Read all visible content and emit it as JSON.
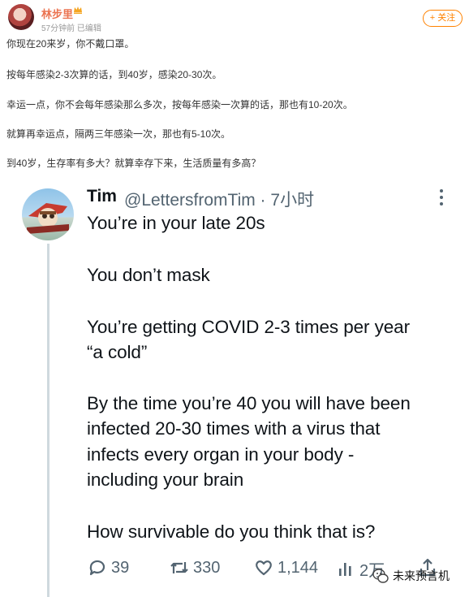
{
  "weibo": {
    "author": "林步里",
    "meta": "57分钟前 已编辑",
    "follow_label": "+ 关注",
    "lines": [
      "你现在20来岁，你不戴口罩。",
      "按每年感染2-3次算的话，到40岁，感染20-30次。",
      "幸运一点，你不会每年感染那么多次，按每年感染一次算的话，那也有10-20次。",
      "就算再幸运点，隔两三年感染一次，那也有5-10次。",
      "到40岁，生存率有多大？就算幸存下来，生活质量有多高？"
    ]
  },
  "tweet": {
    "name": "Tim",
    "handle_time": "@LettersfromTim · 7小时",
    "lines": [
      "You’re in your late 20s",
      "You don’t mask",
      "You’re getting COVID 2-3 times per year",
      "“a cold”",
      "By the time you’re 40 you will have been",
      "infected 20-30 times with a virus that",
      "infects every organ in your body -",
      "including your brain",
      "How survivable do you think that is?"
    ],
    "actions": {
      "replies": "39",
      "retweets": "330",
      "likes": "1,144",
      "views": "2万"
    }
  },
  "watermark": "未来预言机",
  "colors": {
    "weibo_accent": "#eb7350",
    "follow_orange": "#ff8200",
    "tweet_gray": "#536471",
    "tweet_text": "#0f1419"
  },
  "icons": [
    "crown-icon",
    "more-icon",
    "reply-icon",
    "retweet-icon",
    "like-icon",
    "views-icon",
    "share-icon",
    "wechat-icon"
  ]
}
